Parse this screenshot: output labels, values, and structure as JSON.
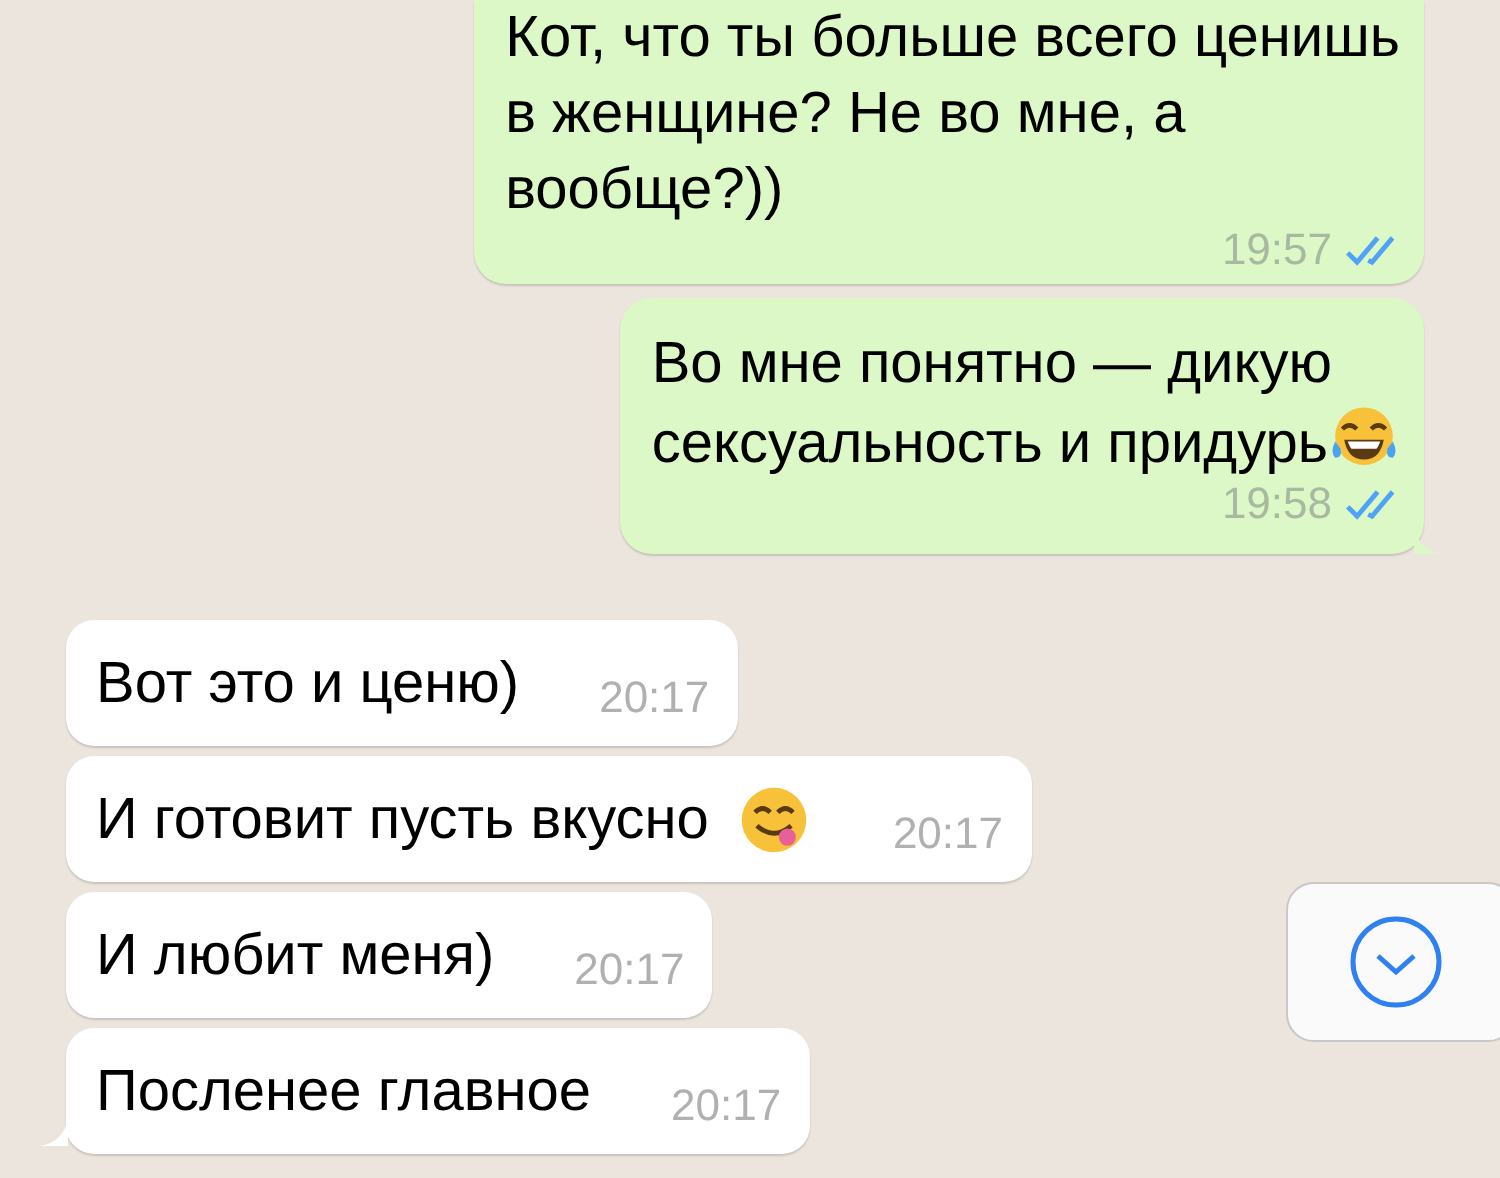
{
  "messages": [
    {
      "kind": "outgoing",
      "parts": [
        {
          "kind": "text",
          "text": "Кот, что ты больше всего ценишь\nв женщине? Не во мне, а\nвообще?))"
        }
      ],
      "time": "19:57",
      "read": true,
      "tail": false
    },
    {
      "kind": "outgoing",
      "parts": [
        {
          "kind": "text",
          "text": "Во мне понятно — дикую\nсексуальность и придурь"
        },
        {
          "kind": "laughing-emoji"
        }
      ],
      "time": "19:58",
      "read": true,
      "tail": true
    },
    {
      "kind": "incoming",
      "parts": [
        {
          "kind": "text",
          "text": "Вот это и ценю)"
        }
      ],
      "time": "20:17",
      "tail": false
    },
    {
      "kind": "incoming",
      "parts": [
        {
          "kind": "text",
          "text": "И готовит пусть вкусно"
        },
        {
          "kind": "yum-emoji"
        }
      ],
      "time": "20:17",
      "tail": false
    },
    {
      "kind": "incoming",
      "parts": [
        {
          "kind": "text",
          "text": "И любит меня)"
        }
      ],
      "time": "20:17",
      "tail": false
    },
    {
      "kind": "incoming",
      "parts": [
        {
          "kind": "text",
          "text": "Посленее главное"
        }
      ],
      "time": "20:17",
      "tail": true
    }
  ],
  "scroll_down_button": {
    "visible": true
  }
}
